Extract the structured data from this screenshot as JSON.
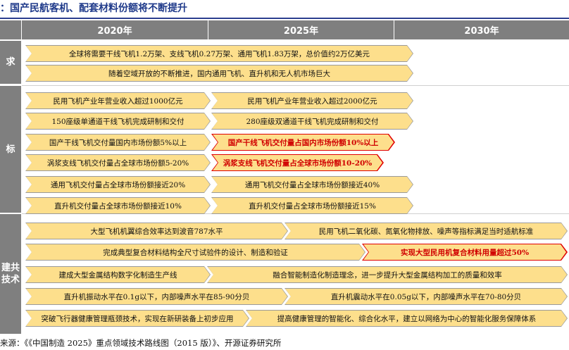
{
  "title": "：国产民航客机、配套材料份额将不断提升",
  "header": {
    "col1": "2020年",
    "col2": "2025年",
    "col3": "2030年"
  },
  "row_labels": {
    "demand": "求",
    "target": "标",
    "key_tech": "建共\n技术"
  },
  "arrows": [
    {
      "text": "全球将需要干线飞机1.2万架、支线飞机0.27万架、通用飞机1.83万架，总价值约2万亿美元",
      "red": false
    },
    {
      "text": "随着空域开放的不断推进，国内通用飞机、直升机和无人机市场巨大",
      "red": false
    },
    {
      "text": "民用飞机产业年营业收入超过1000亿元",
      "red": false
    },
    {
      "text": "民用飞机产业年营业收入超过2000亿元",
      "red": false
    },
    {
      "text": "150座级单通道干线飞机完成研制和交付",
      "red": false
    },
    {
      "text": "280座级双通道干线飞机完成研制和交付",
      "red": false
    },
    {
      "text": "国产干线飞机交付量国内市场份额5%以上",
      "red": false
    },
    {
      "text": "国产干线飞机交付量占国内市场份额10%以上",
      "red": true
    },
    {
      "text": "涡浆支线飞机交付量占全球市场份额5-20%",
      "red": false
    },
    {
      "text": "涡浆支线飞机交付量占全球市场份额10-20%",
      "red": true
    },
    {
      "text": "通用飞机交付量占全球市场份额接近20%",
      "red": false
    },
    {
      "text": "通用飞机交付量占全球市场份额接近40%",
      "red": false
    },
    {
      "text": "直升机交付量占全球市场份额接近10%",
      "red": false
    },
    {
      "text": "直升机交付量占全球市场份额接近15%",
      "red": false
    },
    {
      "text": "大型飞机机翼综合效率达到波音787水平",
      "red": false
    },
    {
      "text": "民用飞机二氧化碳、氮氧化物排放、噪声等指标满足当时适航标准",
      "red": false
    },
    {
      "text": "完成典型复合材料结构全尺寸试验件的设计、制造和验证",
      "red": false
    },
    {
      "text": "实现大型民用机复合材料用量超过50%",
      "red": true
    },
    {
      "text": "建成大型金属结构数字化制造生产线",
      "red": false
    },
    {
      "text": "融合智能制造化制造理念，进一步提升大型金属结构加工的质量和效率",
      "red": false
    },
    {
      "text": "直升机振动水平在0.1g以下，内部噪声水平在85-90分贝",
      "red": false
    },
    {
      "text": "直升机震动水平在0.05g以下，内部噪声水平在70-80分贝",
      "red": false
    },
    {
      "text": "突破飞行器健康管理瓶颈技术，实现在新研装备上初步应用",
      "red": false
    },
    {
      "text": "提高健康管理的智能化、综合化水平，建立以网络为中心的智能化服务保障体系",
      "red": false
    }
  ],
  "source": "来源：《《中国制造 2025》重点领域技术路线图（2015 版）》、开源证券研究所"
}
